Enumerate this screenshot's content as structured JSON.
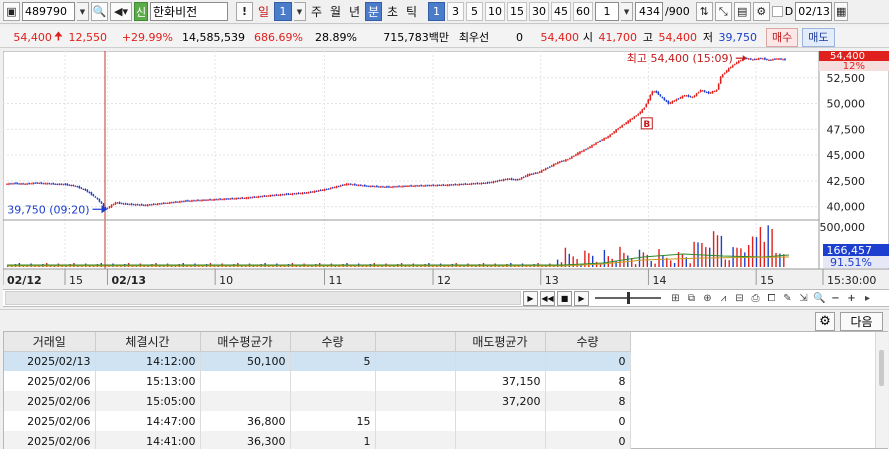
{
  "toolbar": {
    "code": "489790",
    "stock_badge": "신",
    "stock_name": "한화비전",
    "warn": "!",
    "period_day": "일",
    "period_day_value": "1",
    "periods": [
      "주",
      "월",
      "년",
      "분",
      "초",
      "틱"
    ],
    "active_period": "분",
    "intervals": [
      "1",
      "3",
      "5",
      "10",
      "15",
      "30",
      "45",
      "60"
    ],
    "active_interval": "1",
    "custom_interval": "1",
    "count": "434",
    "count_total": "/900",
    "date_label": "D",
    "date": "02/13"
  },
  "info": {
    "price": "54,400",
    "change": "12,550",
    "change_pct": "+29.99%",
    "volume": "14,585,539",
    "vol_ratio": "686.69%",
    "turnover": "28.89%",
    "trade_value": "715,783백만",
    "priority": "최우선",
    "priority_qty": "0",
    "priority_price": "54,400",
    "open_label": "시",
    "open": "41,700",
    "high_label": "고",
    "high": "54,400",
    "low_label": "저",
    "low": "39,750",
    "buy_label": "매수",
    "sell_label": "매도"
  },
  "chart_data": {
    "type": "candlestick",
    "title": "",
    "x_labels": [
      "02/12",
      "15",
      "02/13",
      "10",
      "11",
      "12",
      "13",
      "14",
      "15",
      "15:30:00"
    ],
    "y_ticks": [
      "52,500",
      "50,000",
      "47,500",
      "45,000",
      "42,500",
      "40,000"
    ],
    "y_range": [
      39000,
      54900
    ],
    "volume_ticks": [
      "500,000"
    ],
    "high_annotation": "최고 54,400 (15:09)",
    "low_annotation": "최저 39,750 (09:20)",
    "last_price_label": "54,400",
    "last_pct_label": "12%",
    "last_volume_label": "166,457",
    "last_ratio_label": "91.51%",
    "signal_label": "B",
    "price_path": [
      [
        0,
        42200
      ],
      [
        5,
        42250
      ],
      [
        10,
        42200
      ],
      [
        15,
        42300
      ],
      [
        20,
        42250
      ],
      [
        25,
        42200
      ],
      [
        30,
        42150
      ],
      [
        35,
        42000
      ],
      [
        40,
        41600
      ],
      [
        45,
        40900
      ],
      [
        48,
        40300
      ],
      [
        50,
        39750
      ],
      [
        55,
        40400
      ],
      [
        60,
        40250
      ],
      [
        70,
        40150
      ],
      [
        80,
        40350
      ],
      [
        90,
        40550
      ],
      [
        100,
        40650
      ],
      [
        110,
        40750
      ],
      [
        120,
        40850
      ],
      [
        130,
        41050
      ],
      [
        140,
        41200
      ],
      [
        150,
        41350
      ],
      [
        160,
        41700
      ],
      [
        170,
        42200
      ],
      [
        180,
        42000
      ],
      [
        190,
        41900
      ],
      [
        200,
        42000
      ],
      [
        210,
        42050
      ],
      [
        220,
        42100
      ],
      [
        230,
        42200
      ],
      [
        240,
        42300
      ],
      [
        250,
        42700
      ],
      [
        255,
        42600
      ],
      [
        260,
        43100
      ],
      [
        265,
        43300
      ],
      [
        270,
        43800
      ],
      [
        275,
        44300
      ],
      [
        280,
        44600
      ],
      [
        285,
        45200
      ],
      [
        290,
        45700
      ],
      [
        295,
        46300
      ],
      [
        300,
        46800
      ],
      [
        305,
        47600
      ],
      [
        310,
        48300
      ],
      [
        315,
        49000
      ],
      [
        318,
        49600
      ],
      [
        322,
        51200
      ],
      [
        324,
        51100
      ],
      [
        326,
        50700
      ],
      [
        330,
        50000
      ],
      [
        334,
        50400
      ],
      [
        338,
        50800
      ],
      [
        342,
        50600
      ],
      [
        346,
        51300
      ],
      [
        350,
        51000
      ],
      [
        354,
        51300
      ],
      [
        356,
        52600
      ],
      [
        360,
        53400
      ],
      [
        364,
        54000
      ],
      [
        368,
        54400
      ],
      [
        372,
        54250
      ],
      [
        376,
        54400
      ],
      [
        380,
        54200
      ],
      [
        384,
        54350
      ],
      [
        388,
        54250
      ]
    ]
  },
  "table": {
    "headers": [
      "거래일",
      "체결시간",
      "매수평균가",
      "수량",
      "",
      "매도평균가",
      "수량"
    ],
    "rows": [
      {
        "date": "2025/02/13",
        "time": "14:12:00",
        "buy_avg": "50,100",
        "buy_qty": "5",
        "sell_avg": "",
        "sell_qty": "0"
      },
      {
        "date": "2025/02/06",
        "time": "15:13:00",
        "buy_avg": "",
        "buy_qty": "",
        "sell_avg": "37,150",
        "sell_qty": "8"
      },
      {
        "date": "2025/02/06",
        "time": "15:05:00",
        "buy_avg": "",
        "buy_qty": "",
        "sell_avg": "37,200",
        "sell_qty": "8"
      },
      {
        "date": "2025/02/06",
        "time": "14:47:00",
        "buy_avg": "36,800",
        "buy_qty": "15",
        "sell_avg": "",
        "sell_qty": "0"
      },
      {
        "date": "2025/02/06",
        "time": "14:41:00",
        "buy_avg": "36,300",
        "buy_qty": "1",
        "sell_avg": "",
        "sell_qty": "0"
      }
    ]
  },
  "lower": {
    "next_label": "다음"
  }
}
